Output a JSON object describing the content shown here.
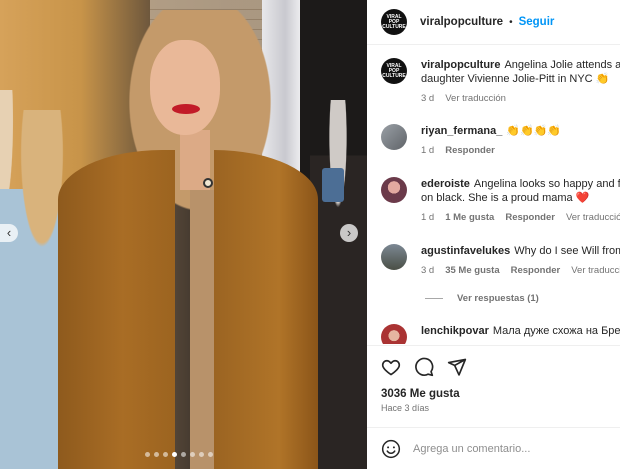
{
  "post": {
    "username": "viralpopculture",
    "follow_label": "Seguir",
    "separator": "•",
    "brand_avatar_text": [
      "VIRAL POP",
      "CULTURE"
    ]
  },
  "media": {
    "prev_label": "‹",
    "next_label": "›",
    "dot_count": 8,
    "active_dot": 3
  },
  "caption": {
    "username": "viralpopculture",
    "text": "Angelina Jolie attends a",
    "text_line2": "daughter Vivienne Jolie-Pitt in NYC 👏",
    "time": "3 d",
    "translate": "Ver traducción"
  },
  "comments": [
    {
      "username": "riyan_fermana_",
      "text": "👏👏👏👏",
      "time": "1 d",
      "likes": "",
      "reply": "Responder",
      "translate": ""
    },
    {
      "username": "ederoiste",
      "text": "Angelina looks so happy and fe",
      "text_line2": "on black. She is a proud mama ❤️",
      "time": "1 d",
      "likes": "1 Me gusta",
      "reply": "Responder",
      "translate": "Ver traducción"
    },
    {
      "username": "agustinfavelukes",
      "text": "Why do I see Will from",
      "time": "3 d",
      "likes": "35 Me gusta",
      "reply": "Responder",
      "translate": "Ver traducción"
    },
    {
      "username": "lenchikpovar",
      "text": "Мала дуже схожа на Бред"
    }
  ],
  "view_replies": "Ver respuestas (1)",
  "actions": {
    "like_icon": "heart-icon",
    "comment_icon": "comment-icon",
    "share_icon": "paper-plane-icon"
  },
  "likes_count": "3036 Me gusta",
  "posted": "Hace 3 días",
  "add_comment": {
    "placeholder": "Agrega un comentario...",
    "emoji_icon": "smiley-icon"
  },
  "colors": {
    "accent": "#0095f6",
    "text": "#262626",
    "muted": "#737373"
  }
}
